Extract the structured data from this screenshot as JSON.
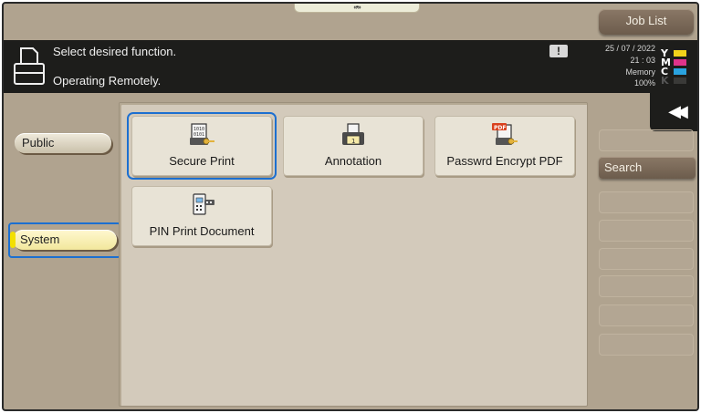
{
  "header": {
    "job_list_label": "Job List",
    "top_handle_label": "«•»"
  },
  "message_bar": {
    "line1": "Select desired function.",
    "line2": "Operating Remotely.",
    "alert_symbol": "!",
    "date": "25 / 07 / 2022",
    "time": "21 : 03",
    "memory_label": "Memory",
    "memory_value": "100%",
    "toner": [
      {
        "letter": "Y",
        "color": "#f2d21a"
      },
      {
        "letter": "M",
        "color": "#e0338a"
      },
      {
        "letter": "C",
        "color": "#2aa3e0"
      },
      {
        "letter": "K",
        "color": "#1d1d1b"
      }
    ]
  },
  "back_button_symbol": "◀◀",
  "sidebar": {
    "public_label": "Public",
    "system_label": "System"
  },
  "functions": [
    {
      "label": "Secure Print",
      "icon": "secure-print-icon"
    },
    {
      "label": "Annotation",
      "icon": "annotation-icon"
    },
    {
      "label": "Passwrd Encrypt PDF",
      "icon": "encrypt-pdf-icon"
    },
    {
      "label": "PIN Print Document",
      "icon": "pin-print-icon"
    }
  ],
  "pdf_badge": "PDF",
  "right_panel": {
    "search_label": "Search"
  },
  "colors": {
    "focus": "#1c6fd0",
    "background": "#b0a38f",
    "message_bar": "#1d1d1b"
  }
}
